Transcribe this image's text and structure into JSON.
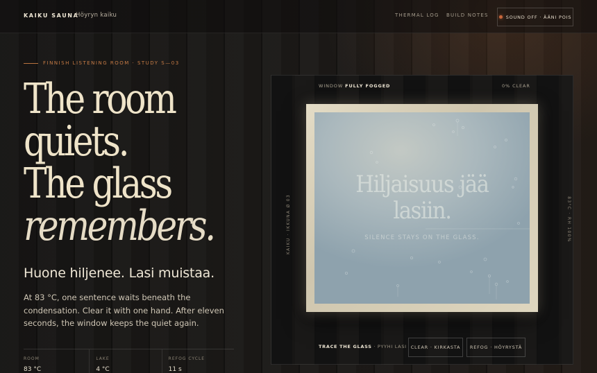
{
  "header": {
    "brand": "KAIKU SAUNA",
    "brand_sub": "Höyryn kaiku",
    "nav": [
      "THERMAL LOG",
      "BUILD NOTES"
    ],
    "sound_button": "SOUND OFF · ÄÄNI POIS"
  },
  "hero": {
    "kicker": "FINNISH LISTENING ROOM · STUDY S—03",
    "headline": [
      "The room",
      "quiets.",
      "The glass",
      "remembers."
    ],
    "finnish": "Huone hiljenee. Lasi muistaa.",
    "body": "At 83 °C, one sentence waits beneath the condensation. Clear it with one hand. After eleven seconds, the window keeps the quiet again."
  },
  "stats": [
    {
      "label": "ROOM",
      "value": "83 °C"
    },
    {
      "label": "LAKE",
      "value": "4 °C"
    },
    {
      "label": "REFOG CYCLE",
      "value": "11 s"
    }
  ],
  "window": {
    "state_prefix": "WINDOW",
    "state": "FULLY FOGGED",
    "clear_percent": "0% CLEAR",
    "text_fi_line1": "Hiljaisuus jää",
    "text_fi_line2": "lasiin.",
    "text_en": "SILENCE STAYS ON THE GLASS.",
    "side_left": "KAIKU · IKKUNA Ø 03",
    "side_right": "83°C · RH 100%",
    "trace_bold": "TRACE THE GLASS",
    "trace_rest": " · PYYHI LASI",
    "clear_button": "CLEAR · KIRKASTA",
    "refog_button": "REFOG · HÖYRYSTÄ"
  },
  "colors": {
    "accent": "#c67b45",
    "glass": "#aab8bd",
    "cream": "#efe4c9"
  }
}
